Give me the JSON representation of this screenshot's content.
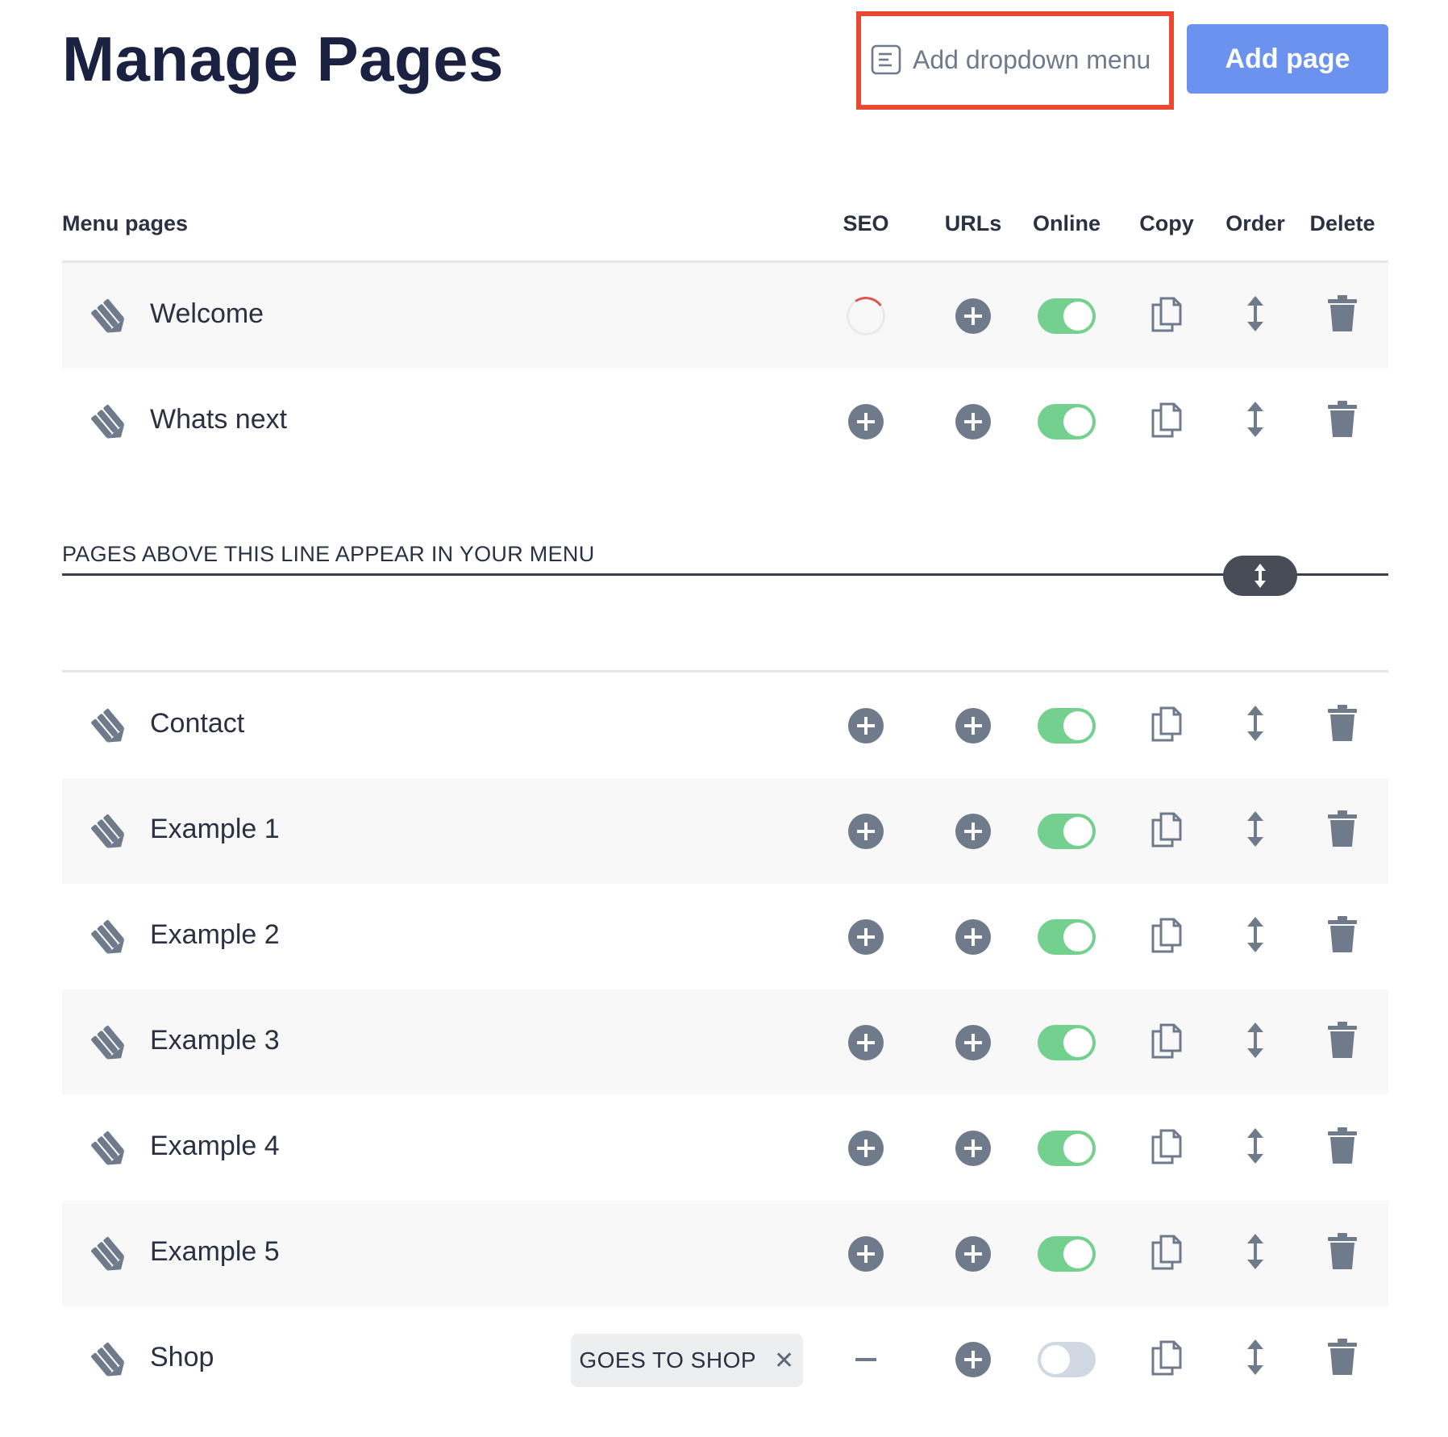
{
  "header": {
    "title": "Manage Pages",
    "dropdown_label": "Add dropdown menu",
    "add_page_label": "Add page"
  },
  "columns": {
    "menu_pages": "Menu pages",
    "seo": "SEO",
    "urls": "URLs",
    "online": "Online",
    "copy": "Copy",
    "order": "Order",
    "delete": "Delete"
  },
  "divider": {
    "label": "PAGES ABOVE THIS LINE APPEAR IN YOUR MENU"
  },
  "menu_pages": [
    {
      "name": "Welcome",
      "seo": "loading",
      "online": true
    },
    {
      "name": "Whats next",
      "seo": "add",
      "online": true
    }
  ],
  "other_pages": [
    {
      "name": "Contact",
      "seo": "add",
      "online": true
    },
    {
      "name": "Example 1",
      "seo": "add",
      "online": true
    },
    {
      "name": "Example 2",
      "seo": "add",
      "online": true
    },
    {
      "name": "Example 3",
      "seo": "add",
      "online": true
    },
    {
      "name": "Example 4",
      "seo": "add",
      "online": true
    },
    {
      "name": "Example 5",
      "seo": "add",
      "online": true
    },
    {
      "name": "Shop",
      "seo": "none",
      "online": false,
      "tag": "GOES TO SHOP"
    }
  ],
  "colors": {
    "accent": "#6b92ef",
    "toggle_on": "#73d08e",
    "toggle_off": "#cfd8e3",
    "icon": "#6f7a8b",
    "highlight": "#e94833"
  },
  "icons": {
    "edit": "pencil-icon",
    "seo": "plus-circle-icon",
    "urls": "plus-circle-icon",
    "copy": "copy-icon",
    "order": "drag-vertical-icon",
    "delete": "trash-icon"
  }
}
